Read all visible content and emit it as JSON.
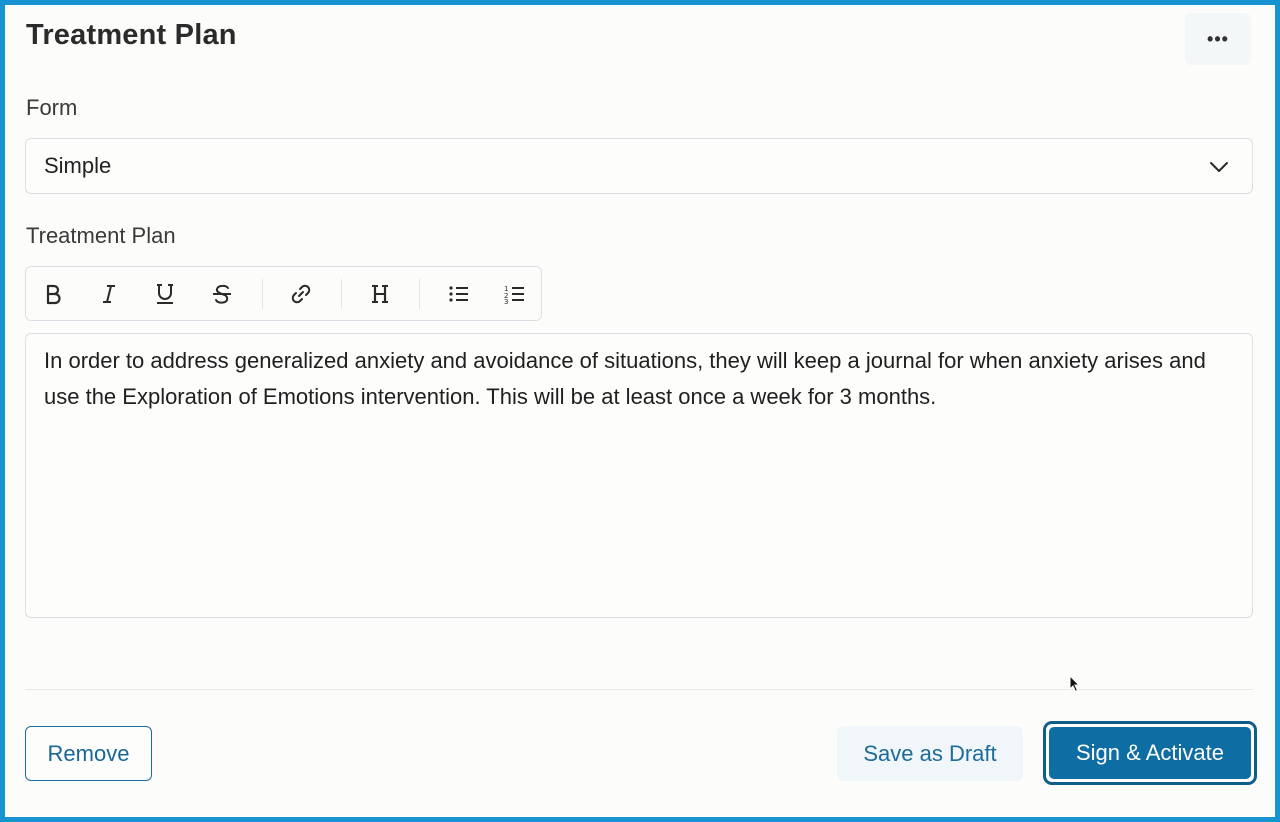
{
  "header": {
    "title": "Treatment Plan",
    "more_icon": "ellipsis-horizontal-icon",
    "more_label": "•••"
  },
  "form_field": {
    "label": "Form",
    "selected": "Simple",
    "icon": "chevron-down-icon"
  },
  "plan_field": {
    "label": "Treatment Plan",
    "toolbar": [
      {
        "name": "bold",
        "icon": "bold-icon"
      },
      {
        "name": "italic",
        "icon": "italic-icon"
      },
      {
        "name": "underline",
        "icon": "underline-icon"
      },
      {
        "name": "strikethrough",
        "icon": "strikethrough-icon"
      },
      {
        "name": "link",
        "icon": "link-icon"
      },
      {
        "name": "heading",
        "icon": "heading-icon"
      },
      {
        "name": "bullet-list",
        "icon": "bullet-list-icon"
      },
      {
        "name": "numbered-list",
        "icon": "numbered-list-icon"
      }
    ],
    "content": "In order to address generalized anxiety and avoidance of situations, they will keep a journal for when anxiety arises and use the Exploration of Emotions intervention. This will be at least once a week for 3 months."
  },
  "footer": {
    "remove_label": "Remove",
    "draft_label": "Save as Draft",
    "sign_label": "Sign & Activate"
  },
  "colors": {
    "accent": "#0e6da3",
    "frame_border": "#1793d1",
    "background": "#fcfcfa"
  }
}
